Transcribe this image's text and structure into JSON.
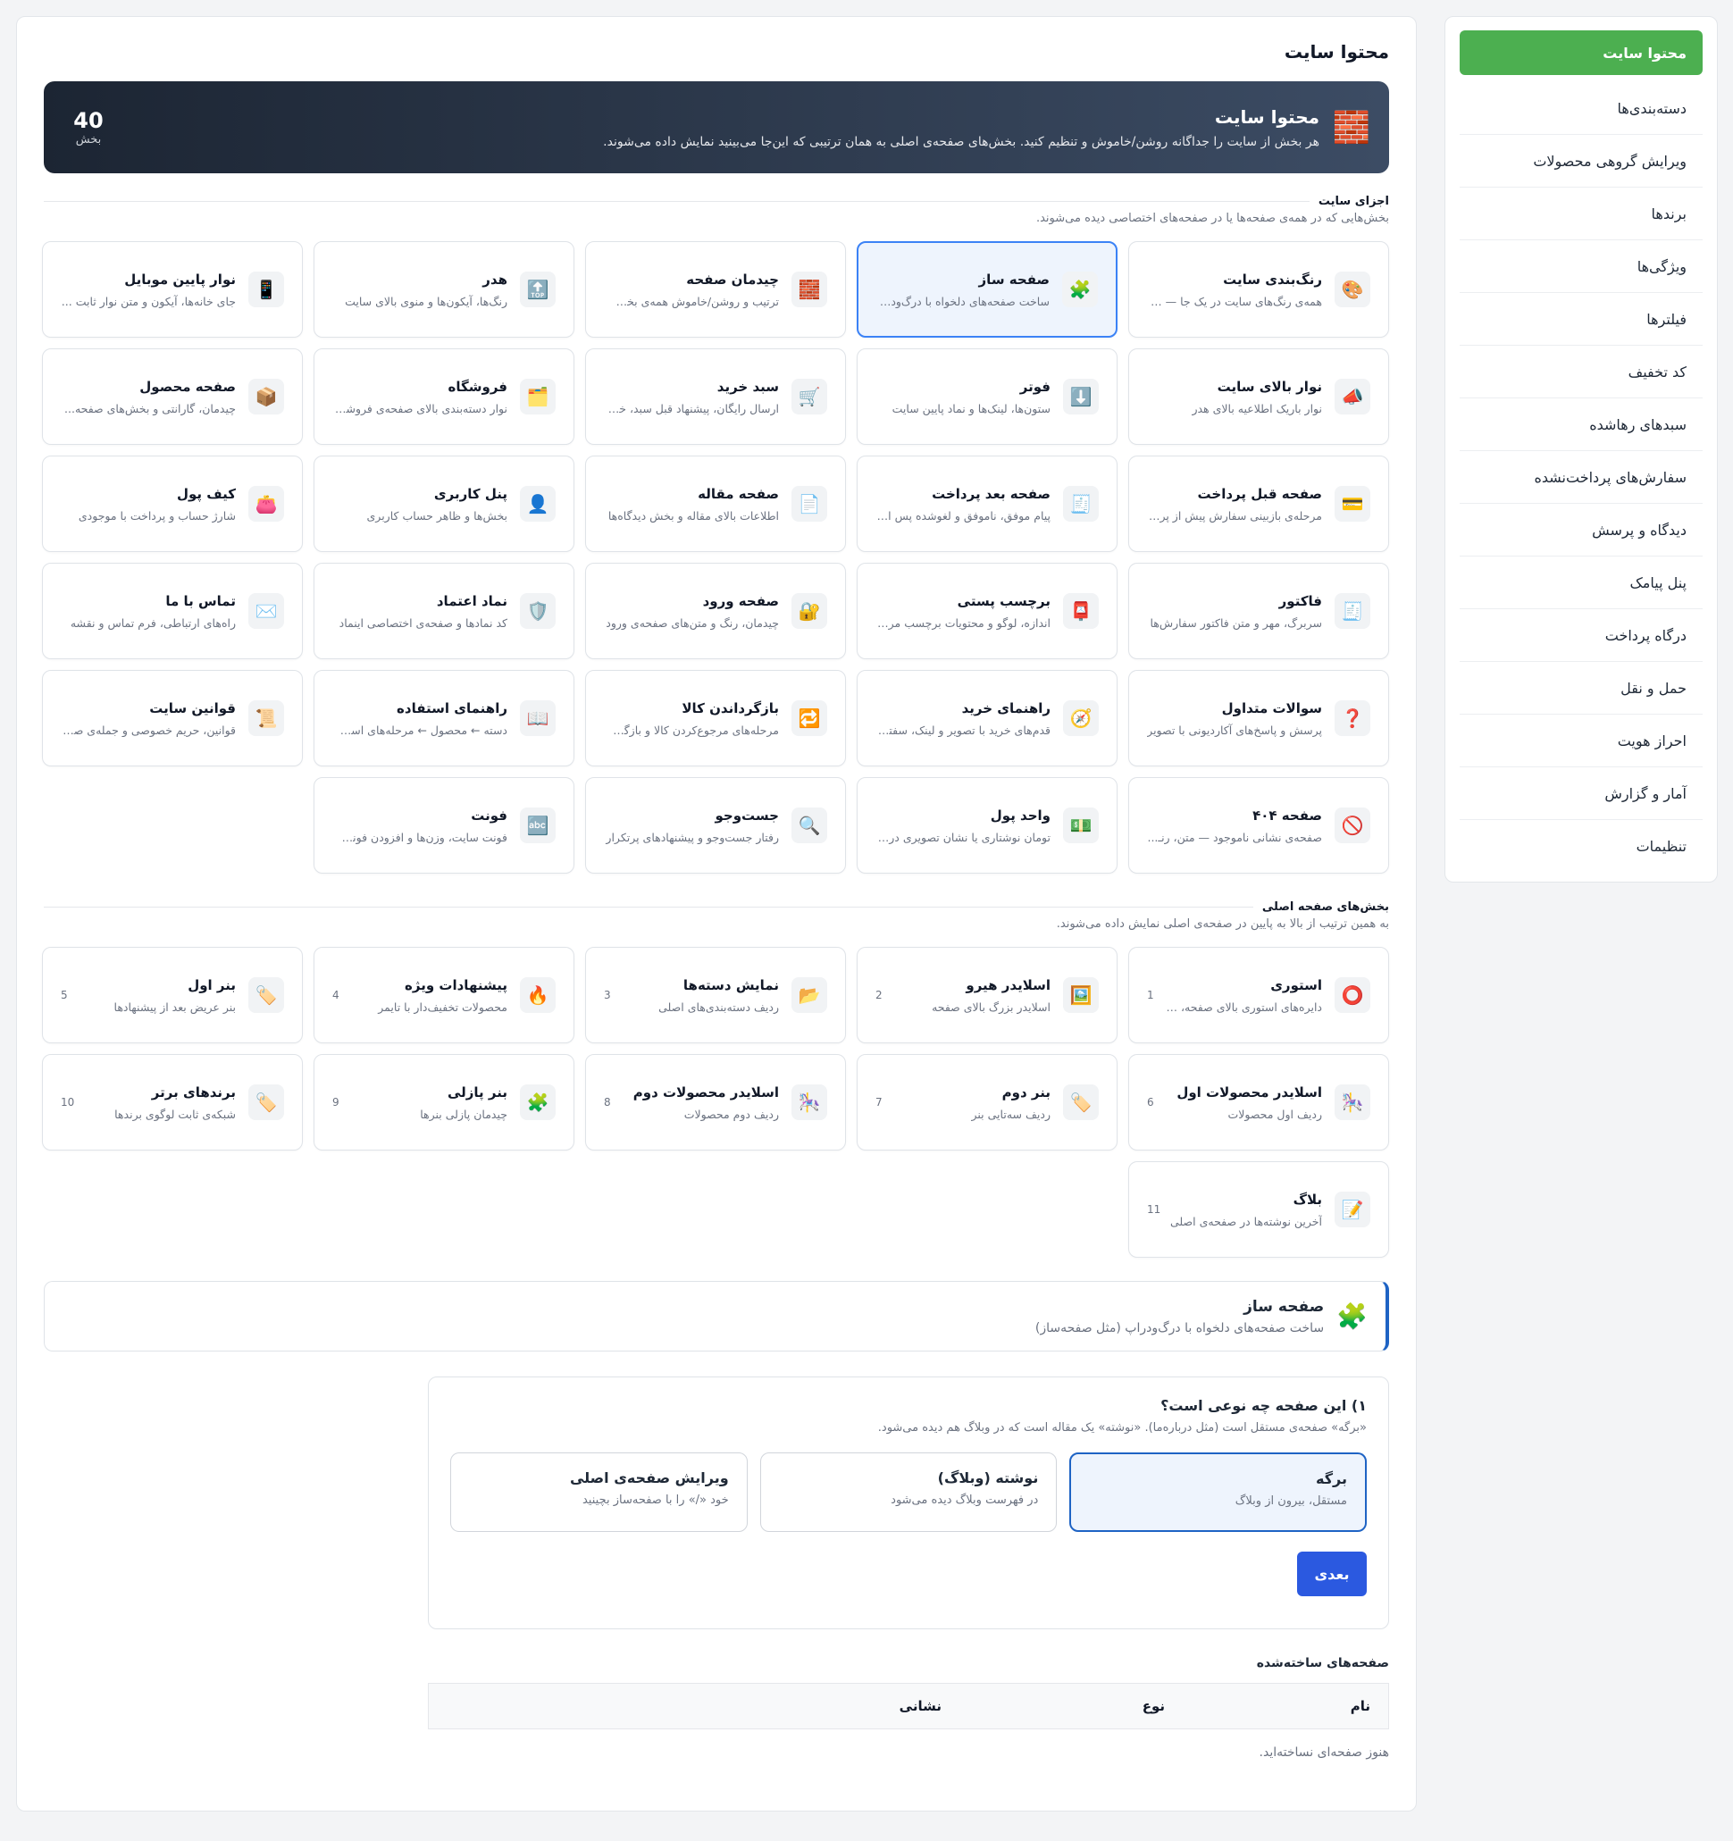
{
  "sidebar": {
    "items": [
      {
        "label": "محتوا سایت",
        "active": true
      },
      {
        "label": "دسته‌بندی‌ها"
      },
      {
        "label": "ویرایش گروهی محصولات"
      },
      {
        "label": "برندها"
      },
      {
        "label": "ویژگی‌ها"
      },
      {
        "label": "فیلترها"
      },
      {
        "label": "کد تخفیف"
      },
      {
        "label": "سبدهای رهاشده"
      },
      {
        "label": "سفارش‌های پرداخت‌نشده"
      },
      {
        "label": "دیدگاه و پرسش"
      },
      {
        "label": "پنل پیامک"
      },
      {
        "label": "درگاه پرداخت"
      },
      {
        "label": "حمل و نقل"
      },
      {
        "label": "احراز هویت"
      },
      {
        "label": "آمار و گزارش"
      },
      {
        "label": "تنظیمات"
      }
    ]
  },
  "page": {
    "title": "محتوا سایت"
  },
  "hero": {
    "title": "محتوا سایت",
    "description": "هر بخش از سایت را جداگانه روشن/خاموش و تنظیم کنید. بخش‌های صفحه‌ی اصلی به همان ترتیبی که این‌جا می‌بینید نمایش داده می‌شوند.",
    "count": "40",
    "count_unit": "بخش",
    "icon": "brick-icon"
  },
  "site_parts": {
    "title": "اجزای سایت",
    "description": "بخش‌هایی که در همه‌ی صفحه‌ها یا در صفحه‌های اختصاصی دیده می‌شوند.",
    "cards": [
      {
        "title": "رنگ‌بندی سایت",
        "desc": "همه‌ی رنگ‌های سایت در یک جا — پ...",
        "icon": "🎨"
      },
      {
        "title": "صفحه ساز",
        "desc": "ساخت صفحه‌های دلخواه با درگ‌ودرا...",
        "icon": "🧩",
        "selected": true
      },
      {
        "title": "چیدمان صفحه",
        "desc": "ترتیب و روشن/خاموش همه‌ی بخش...",
        "icon": "🧱"
      },
      {
        "title": "هدر",
        "desc": "رنگ‌ها، آیکون‌ها و منوی بالای سایت",
        "icon": "🔝"
      },
      {
        "title": "نوار پایین موبایل",
        "desc": "جای خانه‌ها، آیکون و متن نوار ثابت ...",
        "icon": "📱"
      },
      {
        "title": "نوار بالای سایت",
        "desc": "نوار باریک اطلاعیه بالای هدر",
        "icon": "📣"
      },
      {
        "title": "فوتر",
        "desc": "ستون‌ها، لینک‌ها و نماد پایین سایت",
        "icon": "⬇️"
      },
      {
        "title": "سبد خرید",
        "desc": "ارسال رایگان، پیشنهاد قبل سبد، خری...",
        "icon": "🛒"
      },
      {
        "title": "فروشگاه",
        "desc": "نوار دسته‌بندی بالای صفحه‌ی فروشگاه",
        "icon": "🗂️"
      },
      {
        "title": "صفحه محصول",
        "desc": "چیدمان، گارانتی و بخش‌های صفحه...",
        "icon": "📦"
      },
      {
        "title": "صفحه قبل پرداخت",
        "desc": "مرحله‌ی بازبینی سفارش پیش از پردا...",
        "icon": "💳"
      },
      {
        "title": "صفحه بعد پرداخت",
        "desc": "پیام موفق، ناموفق و لغوشده پس از ...",
        "icon": "🧾"
      },
      {
        "title": "صفحه مقاله",
        "desc": "اطلاعات بالای مقاله و بخش دیدگاه‌ها",
        "icon": "📄"
      },
      {
        "title": "پنل کاربری",
        "desc": "بخش‌ها و ظاهر حساب کاربری",
        "icon": "👤"
      },
      {
        "title": "کیف پول",
        "desc": "شارژ حساب و پرداخت با موجودی",
        "icon": "👛"
      },
      {
        "title": "فاکتور",
        "desc": "سربرگ، مهر و متن فاکتور سفارش‌ها",
        "icon": "🧾"
      },
      {
        "title": "برچسب پستی",
        "desc": "اندازه، لوگو و محتویات برچسب مرسوله",
        "icon": "📮"
      },
      {
        "title": "صفحه ورود",
        "desc": "چیدمان، رنگ و متن‌های صفحه‌ی ورود",
        "icon": "🔐"
      },
      {
        "title": "نماد اعتماد",
        "desc": "کد نمادها و صفحه‌ی اختصاصی اینماد",
        "icon": "🛡️"
      },
      {
        "title": "تماس با ما",
        "desc": "راه‌های ارتباطی، فرم تماس و نقشه",
        "icon": "✉️"
      },
      {
        "title": "سوالات متداول",
        "desc": "پرسش و پاسخ‌های آکاردیونی با تصویر",
        "icon": "❓"
      },
      {
        "title": "راهنمای خرید",
        "desc": "قدم‌های خرید با تصویر و لینک، سفتا...",
        "icon": "🧭"
      },
      {
        "title": "بازگرداندن کالا",
        "desc": "مرحله‌های مرجوع‌کردن کالا و بازگشت...",
        "icon": "🔁"
      },
      {
        "title": "راهنمای استفاده",
        "desc": "دسته ← محصول ← مرحله‌های است...",
        "icon": "📖"
      },
      {
        "title": "قوانین سایت",
        "desc": "قوانین، حریم خصوصی و جمله‌ی صف...",
        "icon": "📜"
      },
      {
        "title": "صفحه ۴۰۴",
        "desc": "صفحه‌ی نشانی ناموجود — متن، رنـ...",
        "icon": "🚫"
      },
      {
        "title": "واحد پول",
        "desc": "تومان نوشتاری یا نشان تصویری در کـ...",
        "icon": "💵"
      },
      {
        "title": "جست‌وجو",
        "desc": "رفتار جست‌وجو و پیشنهادهای پرتکرار",
        "icon": "🔍"
      },
      {
        "title": "فونت",
        "desc": "فونت سایت، وزن‌ها و افزودن فونت ...",
        "icon": "🔤"
      }
    ]
  },
  "home_sections": {
    "title": "بخش‌های صفحه اصلی",
    "description": "به همین ترتیب از بالا به پایین در صفحه‌ی اصلی نمایش داده می‌شوند.",
    "cards": [
      {
        "title": "استوری",
        "desc": "دایره‌های استوری بالای صفحه، با...",
        "icon": "⭕",
        "num": "1"
      },
      {
        "title": "اسلایدر هیرو",
        "desc": "اسلایدر بزرگ بالای صفحه",
        "icon": "🖼️",
        "num": "2"
      },
      {
        "title": "نمایش دسته‌ها",
        "desc": "ردیف دسته‌بندی‌های اصلی",
        "icon": "📂",
        "num": "3"
      },
      {
        "title": "پیشنهادات ویژه",
        "desc": "محصولات تخفیف‌دار با تایمر",
        "icon": "🔥",
        "num": "4"
      },
      {
        "title": "بنر اول",
        "desc": "بنر عریض بعد از پیشنهادها",
        "icon": "🏷️",
        "num": "5"
      },
      {
        "title": "اسلایدر محصولات اول",
        "desc": "ردیف اول محصولات",
        "icon": "🎠",
        "num": "6"
      },
      {
        "title": "بنر دوم",
        "desc": "ردیف سه‌تایی بنر",
        "icon": "🏷️",
        "num": "7"
      },
      {
        "title": "اسلایدر محصولات دوم",
        "desc": "ردیف دوم محصولات",
        "icon": "🎠",
        "num": "8"
      },
      {
        "title": "بنر پازلی",
        "desc": "چیدمان پازلی بنرها",
        "icon": "🧩",
        "num": "9"
      },
      {
        "title": "برندهای برتر",
        "desc": "شبکه‌ی ثابت لوگوی برندها",
        "icon": "🏷️",
        "num": "10"
      },
      {
        "title": "بلاگ",
        "desc": "آخرین نوشته‌ها در صفحه‌ی اصلی",
        "icon": "📝",
        "num": "11"
      }
    ]
  },
  "builder": {
    "title": "صفحه ساز",
    "description": "ساخت صفحه‌های دلخواه با درگ‌ودراپ (مثل صفحه‌ساز)",
    "icon": "🧩"
  },
  "wizard": {
    "question": "۱) این صفحه چه نوعی است؟",
    "description": "«برگه» صفحه‌ی مستقل است (مثل درباره‌ما). «نوشته» یک مقاله است که در وبلاگ هم دیده می‌شود.",
    "options": [
      {
        "title": "برگه",
        "desc": "مستقل، بیرون از وبلاگ",
        "selected": true
      },
      {
        "title": "نوشته (وبلاگ)",
        "desc": "در فهرست وبلاگ دیده می‌شود"
      },
      {
        "title": "ویرایش صفحه‌ی اصلی",
        "desc": "خود «/» را با صفحه‌ساز بچینید"
      }
    ],
    "next_label": "بعدی"
  },
  "created_pages": {
    "title": "صفحه‌های ساخته‌شده",
    "columns": [
      "نام",
      "نوع",
      "نشانی"
    ],
    "empty_message": "هنوز صفحه‌ای نساخته‌اید."
  },
  "colors": {
    "accent_green": "#4caf50",
    "primary_blue": "#2b59e0",
    "hero_dark": "#1c2533"
  }
}
